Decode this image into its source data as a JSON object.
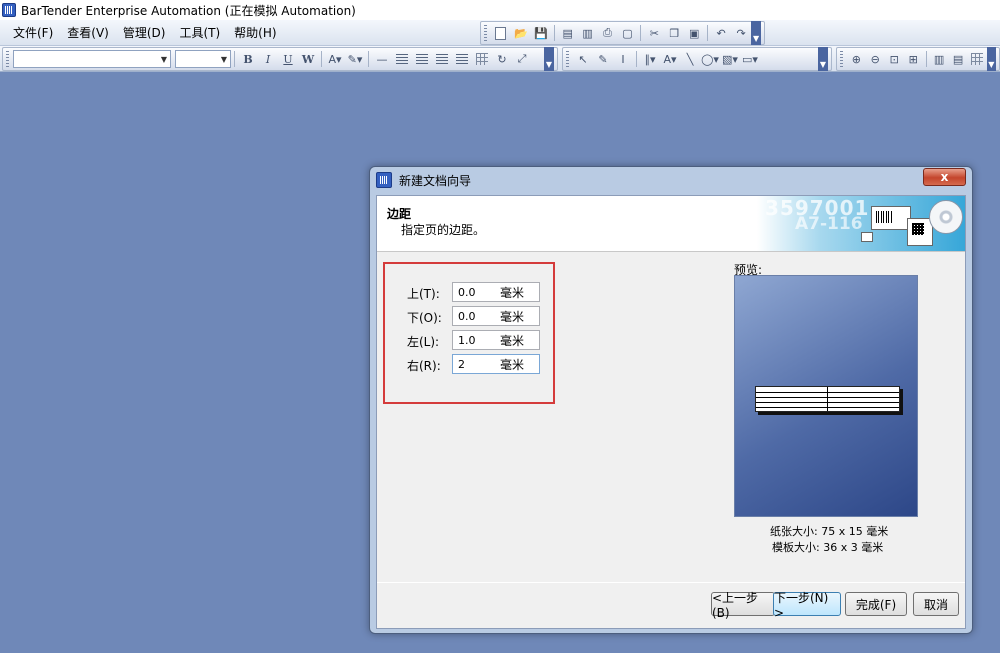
{
  "window": {
    "title": "BarTender Enterprise Automation (正在模拟 Automation)"
  },
  "menu": [
    "文件(F)",
    "查看(V)",
    "管理(D)",
    "工具(T)",
    "帮助(H)"
  ],
  "dialog": {
    "title": "新建文档向导",
    "close_label": "x",
    "header": {
      "title": "边距",
      "subtitle": "指定页的边距。",
      "art_number": "3597001",
      "art_code": "A7-116"
    },
    "margins": [
      {
        "label": "上(T):",
        "value": "0.0",
        "unit": "毫米"
      },
      {
        "label": "下(O):",
        "value": "0.0",
        "unit": "毫米"
      },
      {
        "label": "左(L):",
        "value": "1.0",
        "unit": "毫米"
      },
      {
        "label": "右(R):",
        "value": "2",
        "unit": "毫米"
      }
    ],
    "preview_label": "预览:",
    "paper_size": "纸张大小: 75 x 15 毫米",
    "template_size": "模板大小: 36 x 3 毫米",
    "buttons": {
      "back": "<上一步(B)",
      "next": "下一步(N) >",
      "finish": "完成(F)",
      "cancel": "取消"
    }
  },
  "colors": {
    "desktop": "#6f88b8",
    "highlight_box": "#d43b3b",
    "dialog_frame": "#b9cbe3"
  }
}
